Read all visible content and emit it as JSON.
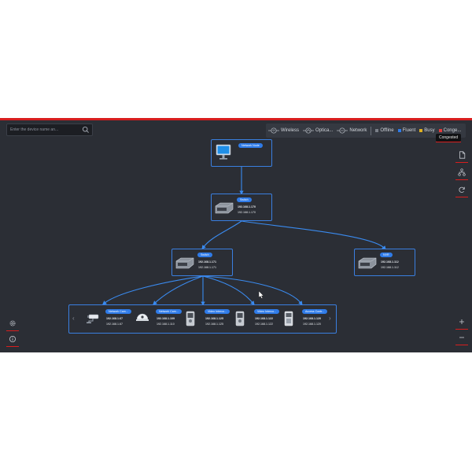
{
  "search": {
    "placeholder": "Enter the device name an..."
  },
  "legend": {
    "wireless": "Wireless",
    "optical": "Optica...",
    "network": "Network",
    "offline": "Offline",
    "fluent": "Fluent",
    "busy": "Busy",
    "congested": "Conge...",
    "colors": {
      "offline": "#7a7f88",
      "fluent": "#2f7be8",
      "busy": "#e0b020",
      "congested": "#e23b3b"
    }
  },
  "tooltip": {
    "text": "Congested"
  },
  "nodes": {
    "root": {
      "badge": "Network Node"
    },
    "switch1": {
      "badge": "Switch",
      "ip1": "192.168.1.170",
      "ip2": "192.168.1.170"
    },
    "switch2": {
      "badge": "Switch",
      "ip1": "192.168.1.171",
      "ip2": "192.168.1.171"
    },
    "nvr": {
      "badge": "NVR",
      "ip1": "192.168.1.112",
      "ip2": "192.168.1.112"
    }
  },
  "devices": [
    {
      "badge": "Network Cam...",
      "ip1": "192.168.1.67",
      "ip2": "192.168.1.67",
      "icon": "bullet-camera-icon"
    },
    {
      "badge": "Network Cam...",
      "ip1": "192.168.1.109",
      "ip2": "192.168.1.110",
      "icon": "dome-camera-icon"
    },
    {
      "badge": "Video Interco...",
      "ip1": "192.168.1.125",
      "ip2": "192.168.1.125",
      "icon": "intercom-icon"
    },
    {
      "badge": "Video Interco...",
      "ip1": "192.168.1.122",
      "ip2": "192.168.1.122",
      "icon": "intercom-icon"
    },
    {
      "badge": "Access Contr...",
      "ip1": "192.168.1.120",
      "ip2": "192.168.1.120",
      "icon": "access-control-icon"
    }
  ]
}
